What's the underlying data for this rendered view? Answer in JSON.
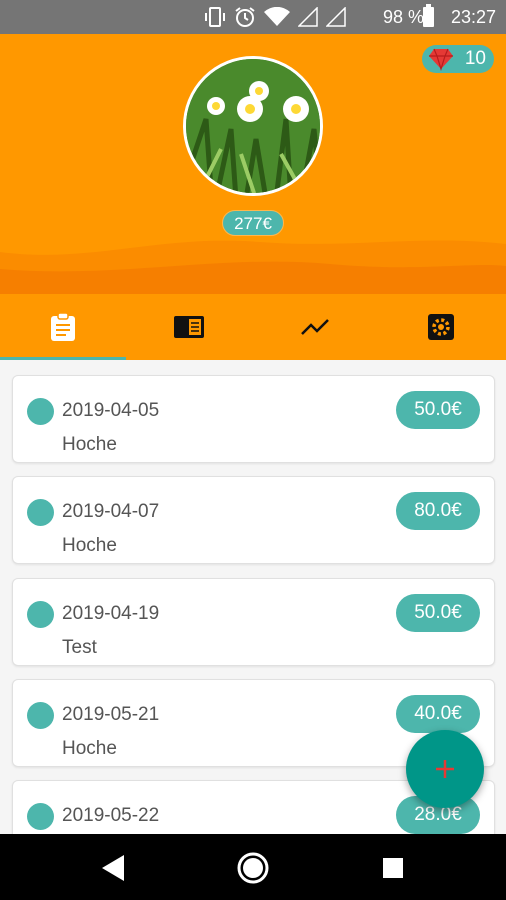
{
  "status_bar": {
    "battery": "98 %",
    "time": "23:27",
    "icons": [
      "vibrate-icon",
      "alarm-icon",
      "wifi-icon",
      "signal-icon",
      "signal-icon",
      "battery-icon"
    ]
  },
  "header": {
    "gem_count": "10",
    "balance": "277€",
    "colors": {
      "background": "#ff9800",
      "wave": "#f57c00",
      "badge": "#4db6ac"
    }
  },
  "tabs": [
    {
      "icon": "clipboard-icon",
      "selected": true
    },
    {
      "icon": "card-icon",
      "selected": false
    },
    {
      "icon": "trending-icon",
      "selected": false
    },
    {
      "icon": "settings-icon",
      "selected": false
    }
  ],
  "entries": [
    {
      "date": "2019-04-05",
      "description": "Hoche",
      "amount": "50.0€"
    },
    {
      "date": "2019-04-07",
      "description": "Hoche",
      "amount": "80.0€"
    },
    {
      "date": "2019-04-19",
      "description": "Test",
      "amount": "50.0€"
    },
    {
      "date": "2019-05-21",
      "description": "Hoche",
      "amount": "40.0€"
    },
    {
      "date": "2019-05-22",
      "description": "",
      "amount": "28.0€"
    }
  ],
  "fab": {
    "icon": "plus-icon",
    "accent": "#009688"
  },
  "nav": {
    "icons": [
      "back-icon",
      "home-icon",
      "recents-icon"
    ]
  }
}
